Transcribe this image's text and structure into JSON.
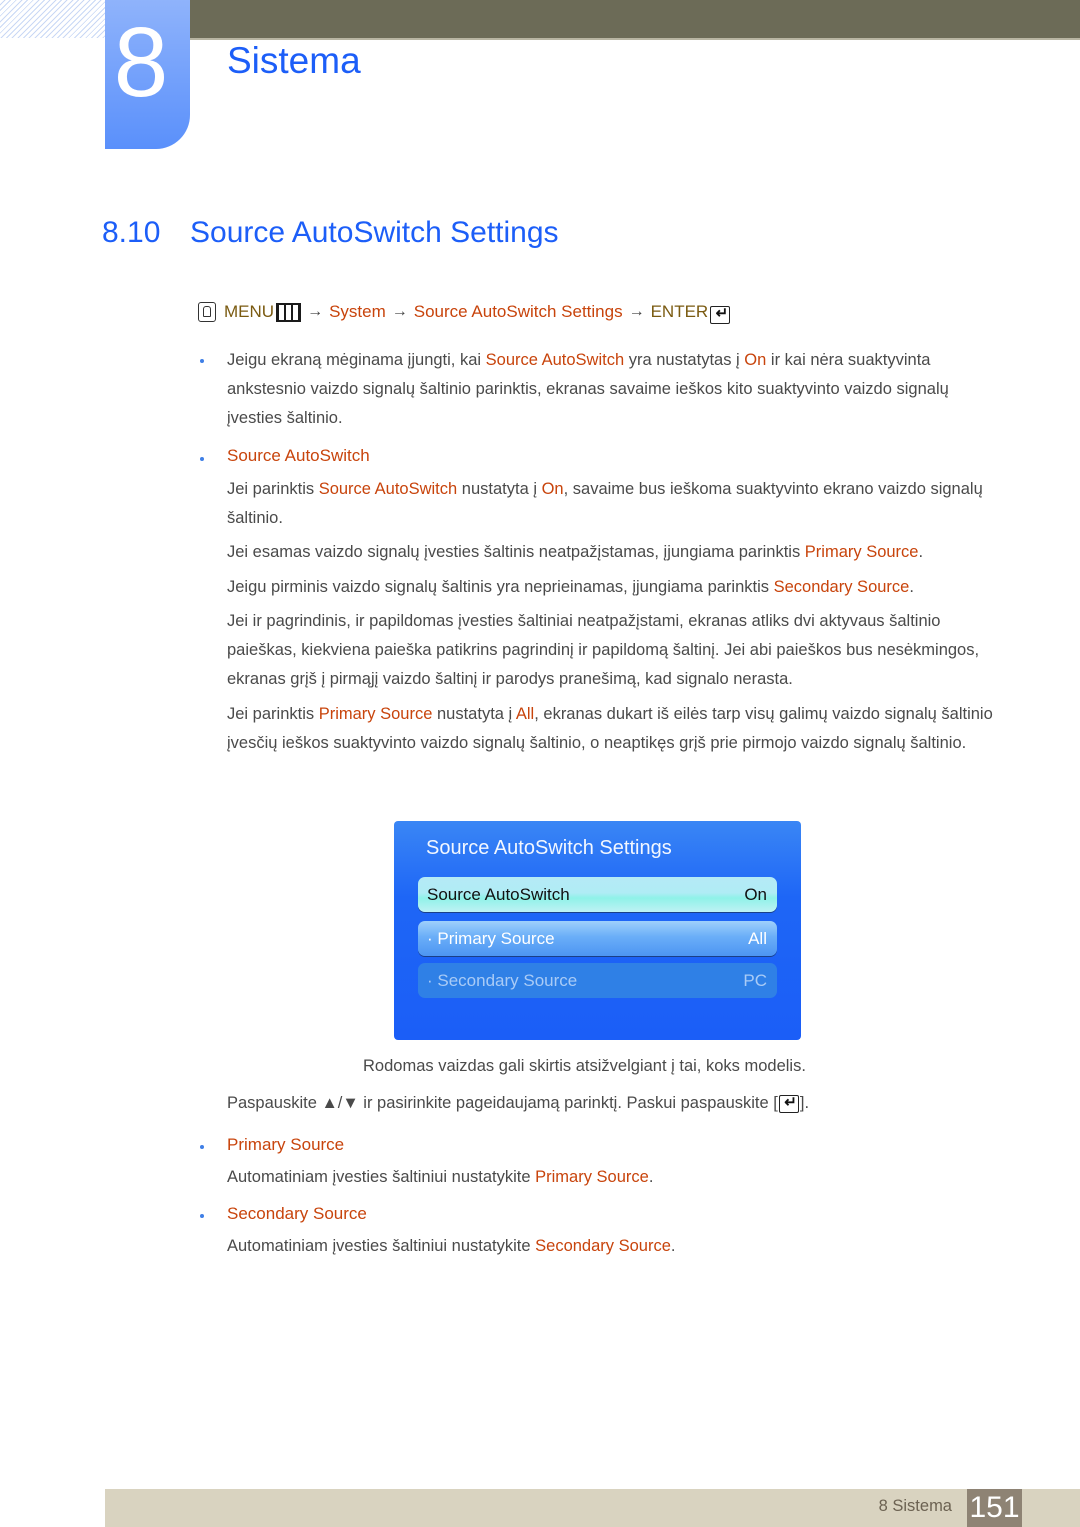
{
  "header": {
    "chapter_number": "8",
    "chapter_title": "Sistema"
  },
  "section": {
    "number": "8.10",
    "title": "Source AutoSwitch Settings"
  },
  "menu_path": {
    "menu": "MENU",
    "arrow": "→",
    "system": "System",
    "page": "Source AutoSwitch Settings",
    "enter": "ENTER",
    "icons": [
      "hand-remote-icon",
      "menu-icon",
      "enter-icon"
    ]
  },
  "intro": {
    "t1": "Jeigu ekraną mėginama įjungti, kai ",
    "h1": "Source AutoSwitch",
    "t2": " yra nustatytas į ",
    "h2": "On",
    "t3": " ir kai nėra suaktyvinta ankstesnio vaizdo signalų šaltinio parinktis, ekranas savaime ieškos kito suaktyvinto vaizdo signalų įvesties šaltinio."
  },
  "sas_section": {
    "heading": "Source AutoSwitch",
    "p1": {
      "t1": "Jei parinktis ",
      "h1": "Source AutoSwitch",
      "t2": " nustatyta į ",
      "h2": "On",
      "t3": ", savaime bus ieškoma suaktyvinto ekrano vaizdo signalų šaltinio."
    },
    "p2": {
      "t1": "Jei esamas vaizdo signalų įvesties šaltinis neatpažįstamas, įjungiama parinktis ",
      "h1": "Primary Source",
      "t2": "."
    },
    "p3": {
      "t1": "Jeigu pirminis vaizdo signalų šaltinis yra neprieinamas, įjungiama parinktis ",
      "h1": "Secondary Source",
      "t2": "."
    },
    "p4": "Jei ir pagrindinis, ir papildomas įvesties šaltiniai neatpažįstami, ekranas atliks dvi aktyvaus šaltinio paieškas, kiekviena paieška patikrins pagrindinį ir papildomą šaltinį. Jei abi paieškos bus nesėkmingos, ekranas grįš į pirmąjį vaizdo šaltinį ir parodys pranešimą, kad signalo nerasta.",
    "p5": {
      "t1": "Jei parinktis ",
      "h1": "Primary Source",
      "t2": " nustatyta į ",
      "h2": "All",
      "t3": ", ekranas dukart iš eilės tarp visų galimų vaizdo signalų šaltinio įvesčių ieškos suaktyvinto vaizdo signalų šaltinio, o neaptikęs grįš prie pirmojo vaizdo signalų šaltinio."
    }
  },
  "osd": {
    "title": "Source AutoSwitch Settings",
    "rows": [
      {
        "label": "Source AutoSwitch",
        "value": "On",
        "state": "selected"
      },
      {
        "label": "· Primary Source",
        "value": "All",
        "state": "enabled"
      },
      {
        "label": "· Secondary Source",
        "value": "PC",
        "state": "disabled"
      }
    ]
  },
  "caption": "Rodomas vaizdas gali skirtis atsižvelgiant į tai, koks modelis.",
  "instruction": {
    "t1": "Paspauskite ▲/▼ ir pasirinkite pageidaujamą parinktį. Paskui paspauskite [",
    "t2": "]."
  },
  "primary_section": {
    "heading": "Primary Source",
    "t1": "Automatiniam įvesties šaltiniui nustatykite ",
    "h1": "Primary Source",
    "t2": "."
  },
  "secondary_section": {
    "heading": "Secondary Source",
    "t1": "Automatiniam įvesties šaltiniui nustatykite ",
    "h1": "Secondary Source",
    "t2": "."
  },
  "footer": {
    "label": "8 Sistema",
    "page_number": "151"
  },
  "colors": {
    "accent_blue": "#1c5ef8",
    "highlight_red": "#c8440c",
    "menu_gold": "#7a5a10",
    "topbar": "#6c6b57",
    "footer_bg": "#d9d3c0",
    "page_box": "#8e8374"
  }
}
